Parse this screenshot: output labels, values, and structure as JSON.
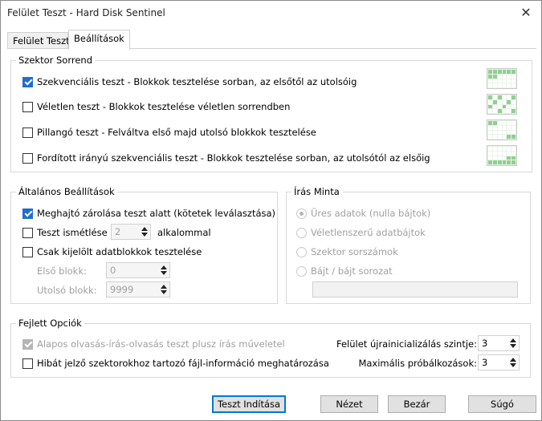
{
  "window": {
    "title": "Felület Teszt - Hard Disk Sentinel",
    "close_glyph": "✕"
  },
  "tabs": [
    {
      "label": "Felület Teszt",
      "active": false
    },
    {
      "label": "Beállítások",
      "active": true
    }
  ],
  "sector_order": {
    "title": "Szektor Sorrend",
    "options": [
      {
        "label": "Szekvenciális teszt - Blokkok tesztelése sorban, az elsőtől az utolsóig",
        "checked": true,
        "icon": "sequential-grid-icon"
      },
      {
        "label": "Véletlen teszt - Blokkok tesztelése véletlen sorrendben",
        "checked": false,
        "icon": "random-grid-icon"
      },
      {
        "label": "Pillangó teszt - Felváltva első majd utolsó blokkok tesztelése",
        "checked": false,
        "icon": "butterfly-grid-icon"
      },
      {
        "label": "Fordított irányú szekvenciális teszt - Blokkok tesztelése sorban, az utolsótól az elsőig",
        "checked": false,
        "icon": "reverse-grid-icon"
      }
    ]
  },
  "general": {
    "title": "Általános Beállítások",
    "lock_drive": {
      "label": "Meghajtó zárolása teszt alatt (kötetek leválasztása)",
      "checked": true
    },
    "repeat": {
      "label": "Teszt ismétlése",
      "checked": false,
      "value": "2",
      "suffix": "alkalommal"
    },
    "selected_only": {
      "label": "Csak kijelölt adatblokkok tesztelése",
      "checked": false
    },
    "first_block": {
      "label": "Első blokk:",
      "value": "0"
    },
    "last_block": {
      "label": "Utolsó blokk:",
      "value": "9999"
    }
  },
  "write_pattern": {
    "title": "Írás Minta",
    "options": [
      {
        "label": "Üres adatok (nulla bájtok)",
        "selected": true
      },
      {
        "label": "Véletlenszerű adatbájtok",
        "selected": false
      },
      {
        "label": "Szektor sorszámok",
        "selected": false
      },
      {
        "label": "Bájt / bájt sorozat",
        "selected": false
      }
    ],
    "pattern_value": ""
  },
  "advanced": {
    "title": "Fejlett Opciók",
    "read_write_read": {
      "label": "Alapos olvasás-írás-olvasás teszt plusz írás műveletel",
      "checked": true,
      "disabled": true
    },
    "file_info": {
      "label": "Hibát jelző szektorokhoz tartozó fájl-információ meghatározása",
      "checked": false
    },
    "reinit_level": {
      "label": "Felület újrainicializálás szintje:",
      "value": "3"
    },
    "max_retries": {
      "label": "Maximális próbálkozások:",
      "value": "3"
    }
  },
  "buttons": {
    "start": "Teszt Indítása",
    "view": "Nézet",
    "close": "Bezár",
    "help": "Súgó"
  }
}
